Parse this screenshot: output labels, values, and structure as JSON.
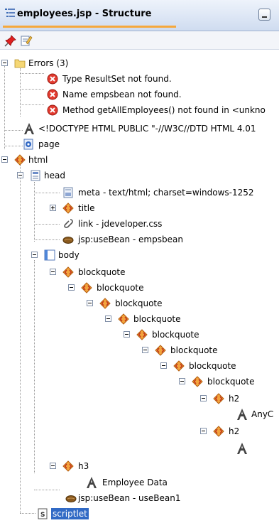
{
  "window": {
    "title": "employees.jsp - Structure"
  },
  "toolbar": {
    "pin_icon": "pin-icon",
    "edit_icon": "edit-icon"
  },
  "tree": {
    "errors_label": "Errors (3)",
    "error_1": "Type ResultSet not found.",
    "error_2": "Name empsbean not found.",
    "error_3": "Method getAllEmployees() not found in <unkno",
    "doctype": "<!DOCTYPE HTML PUBLIC \"-//W3C//DTD HTML 4.01",
    "page": "page",
    "html": "html",
    "head": "head",
    "meta": "meta - text/html; charset=windows-1252",
    "title": "title",
    "link": "link - jdeveloper.css",
    "usebean_head": "jsp:useBean - empsbean",
    "body": "body",
    "blockquote": "blockquote",
    "h2": "h2",
    "text_anyc": "AnyC",
    "h3": "h3",
    "employee_data": "Employee Data",
    "usebean_body": "jsp:useBean - useBean1",
    "scriptlet": "scriptlet"
  }
}
